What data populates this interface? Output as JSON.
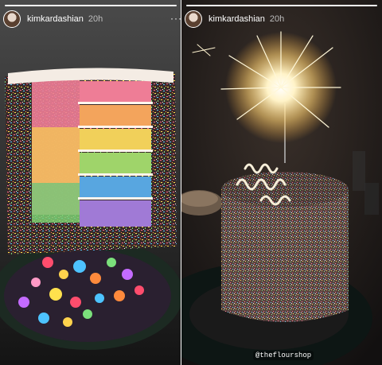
{
  "left_story": {
    "username": "kimkardashian",
    "timestamp": "20h",
    "avatar_icon": "profile-avatar"
  },
  "right_story": {
    "username": "kimkardashian",
    "timestamp": "20h",
    "more_icon": "more-icon",
    "more_label": "···",
    "mention_tag": "@theflourshop",
    "avatar_icon": "profile-avatar"
  }
}
